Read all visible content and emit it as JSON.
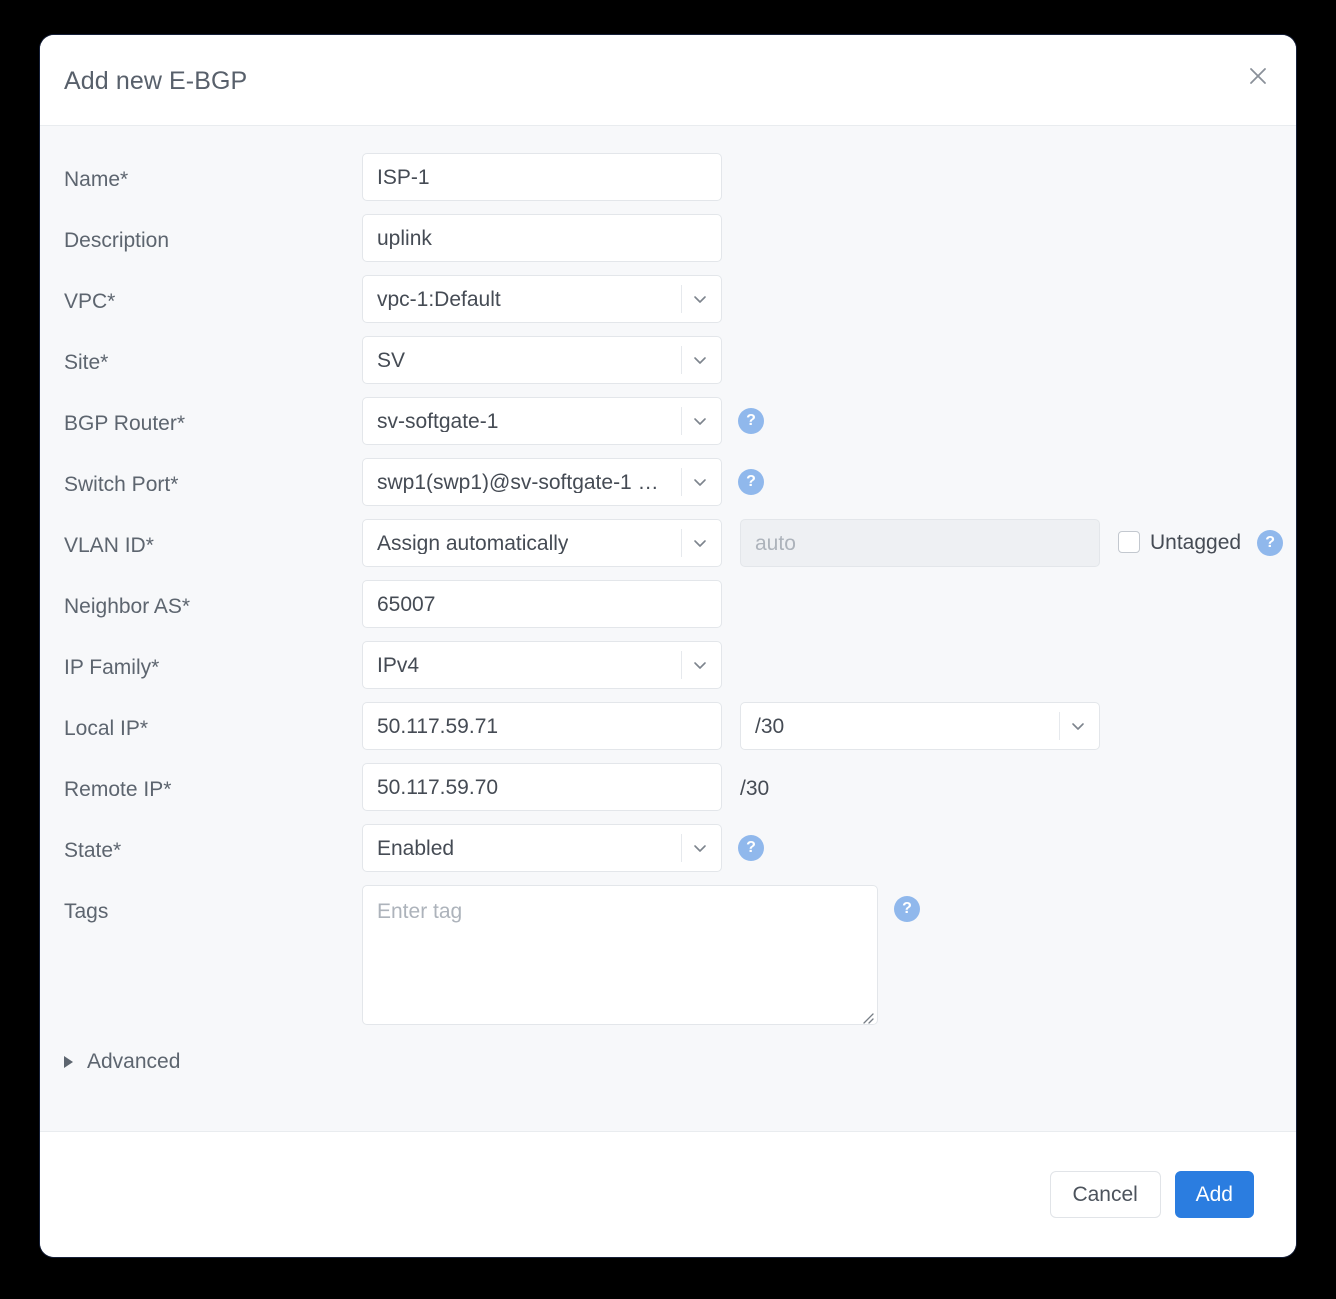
{
  "dialog": {
    "title": "Add new E-BGP",
    "close_icon": "close-icon"
  },
  "form": {
    "rows": [
      {
        "label": "Name*",
        "value": "ISP-1"
      },
      {
        "label": "Description",
        "value": "uplink"
      },
      {
        "label": "VPC*",
        "value": "vpc-1:Default"
      },
      {
        "label": "Site*",
        "value": "SV"
      },
      {
        "label": "BGP Router*",
        "value": "sv-softgate-1"
      },
      {
        "label": "Switch Port*",
        "value": "swp1(swp1)@sv-softgate-1 …"
      },
      {
        "label": "VLAN ID*",
        "value": "Assign automatically"
      },
      {
        "label": "Neighbor AS*",
        "value": "65007"
      },
      {
        "label": "IP Family*",
        "value": "IPv4"
      },
      {
        "label": "Local IP*",
        "value": "50.117.59.71"
      },
      {
        "label": "Remote IP*",
        "value": "50.117.59.70"
      },
      {
        "label": "State*",
        "value": "Enabled"
      },
      {
        "label": "Tags",
        "value": ""
      }
    ],
    "vlan_auto_placeholder": "auto",
    "untagged_label": "Untagged",
    "local_prefix": "/30",
    "remote_prefix": "/30",
    "tags_placeholder": "Enter tag",
    "help_glyph": "?",
    "advanced_label": "Advanced"
  },
  "footer": {
    "cancel_label": "Cancel",
    "add_label": "Add"
  },
  "colors": {
    "accent": "#2b7de0",
    "help_badge": "#90b8ec",
    "body_bg": "#f7f8fa",
    "label_text": "#5d656f",
    "value_text": "#454b54",
    "placeholder_text": "#adb3bb"
  }
}
